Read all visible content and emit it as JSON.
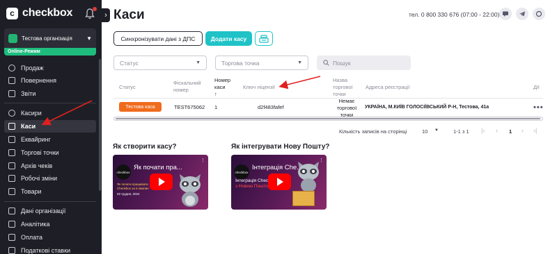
{
  "sidebar": {
    "logo_letter": "c",
    "logo_text": "checkbox",
    "org_name": "Тестова організація",
    "online_mode": "Online-Режим",
    "items": [
      {
        "label": "Продаж"
      },
      {
        "label": "Повернення"
      },
      {
        "label": "Звіти"
      },
      {
        "label": "Касири"
      },
      {
        "label": "Каси"
      },
      {
        "label": "Еквайринг"
      },
      {
        "label": "Торгові точки"
      },
      {
        "label": "Архів чеків"
      },
      {
        "label": "Робочі зміни"
      },
      {
        "label": "Товари"
      },
      {
        "label": "Дані організації"
      },
      {
        "label": "Аналітика"
      },
      {
        "label": "Оплата"
      },
      {
        "label": "Податкові ставки"
      }
    ]
  },
  "header": {
    "title": "Каси",
    "phone": "тел. 0 800 330 676 (07:00 - 22:00)"
  },
  "actions": {
    "sync_label": "Синхронізувати дані з ДПС",
    "add_label": "Додати касу"
  },
  "filters": {
    "status_placeholder": "Статус",
    "point_placeholder": "Торгова точка",
    "search_placeholder": "Пошук"
  },
  "table": {
    "headers": {
      "status": "Статус",
      "fiscal": "Фіскальний номер",
      "number_l1": "Номер",
      "number_l2": "каси",
      "sort_arrow": "↑",
      "license": "Ключ ліцензії",
      "point_l1": "Назва",
      "point_l2": "торгової",
      "point_l3": "точки",
      "address": "Адреса реєстрації",
      "actions": "Дії"
    },
    "rows": [
      {
        "status": "Тестова каса",
        "fiscal": "TEST675062",
        "number": "1",
        "license": "d2f483fafef",
        "point_l1": "Немає",
        "point_l2": "торгової",
        "point_l3": "точки",
        "address": "УКРАЇНА, М.КИЇВ ГОЛОСІЇВСЬКИЙ Р-Н, Тестова, 41а"
      }
    ]
  },
  "pagination": {
    "per_page_label": "Кількість записів на сторінці",
    "per_page_value": "10",
    "range": "1-1 з 1",
    "current_page": "1"
  },
  "videos": [
    {
      "heading": "Як створити касу?",
      "thumb_title": "Як почати пра...",
      "logo": "checkbox",
      "sub_l1": "Як почати працювати",
      "sub_l2": "Checkbox за 5 хвилин",
      "date": "02 грудня, 2024"
    },
    {
      "heading": "Як інтегрувати Нову Пошту?",
      "thumb_title": "Інтеграція Che...",
      "logo": "checkbox",
      "sub_l1": "Інтеграція Checkbox",
      "sub_l2": "з Новою Поштою"
    }
  ],
  "colors": {
    "sidebar_bg": "#1e1f26",
    "accent": "#1fc3c7",
    "online_green": "#1ebd7e",
    "status_orange": "#f06b1d",
    "annotation_red": "#e02020"
  }
}
